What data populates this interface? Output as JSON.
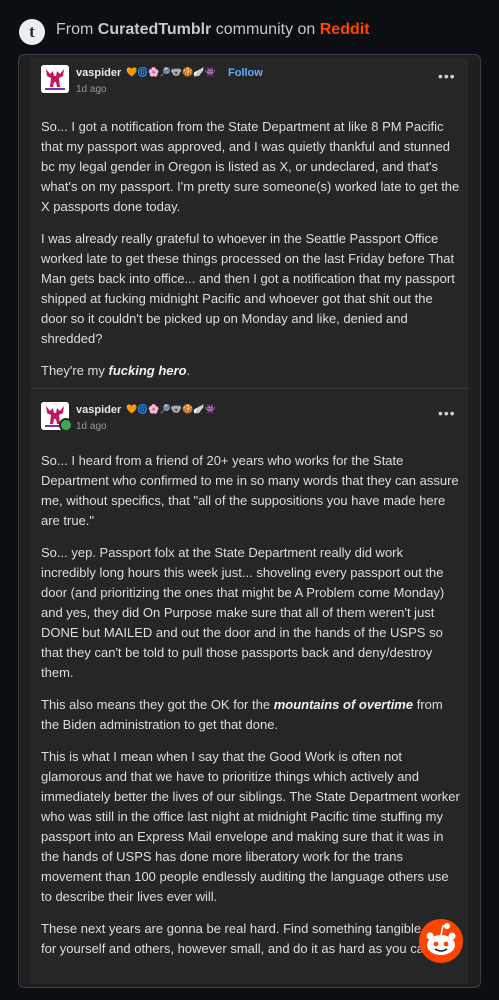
{
  "header": {
    "prefix": "From ",
    "community": "CuratedTumblr",
    "middle": " community on ",
    "site": "Reddit",
    "logo_letter": "t"
  },
  "post1": {
    "username": "vaspider",
    "badges": "🧡🌀🌸🔎🐨🍪🪽👾",
    "follow_label": "Follow",
    "time": "1d ago",
    "more_label": "•••",
    "paragraphs": [
      "So... I got a notification from the State Department at like 8 PM Pacific that my passport was approved, and I was quietly thankful and stunned bc my legal gender in Oregon is listed as X, or undeclared, and that's what's on my passport. I'm pretty sure someone(s) worked late to get the X passports done today.",
      "I was already really grateful to whoever in the Seattle Passport Office worked late to get these things processed on the last Friday before That Man gets back into office... and then I got a notification that my passport shipped at fucking midnight Pacific and whoever got that shit out the door so it couldn't be picked up on Monday and like, denied and shredded?"
    ],
    "p3_prefix": "They're my ",
    "p3_emph": "fucking hero",
    "p3_suffix": "."
  },
  "post2": {
    "username": "vaspider",
    "badges": "🧡🌀🌸🔎🐨🍪🪽👾",
    "time": "1d ago",
    "more_label": "•••",
    "paragraphs": [
      "So... I heard from a friend of 20+ years who works for the State Department who confirmed to me in so many words that they can assure me, without specifics, that \"all of the suppositions you have made here are true.\"",
      "So... yep. Passport folx at the State Department really did work incredibly long hours this week just... shoveling every passport out the door (and prioritizing the ones that might be A Problem come Monday) and yes, they did On Purpose make sure that all of them weren't just DONE but MAILED and out the door and in the hands of the USPS so that they can't be told to pull those passports back and deny/destroy them."
    ],
    "p3_prefix": "This also means they got the OK for the ",
    "p3_emph": "mountains of overtime",
    "p3_suffix": " from the Biden administration to get that done.",
    "paragraphs_after": [
      "This is what I mean when I say that the Good Work is often not glamorous and that we have to prioritize things which actively and immediately better the lives of our siblings. The State Department worker who was still in the office last night at midnight Pacific time stuffing my passport into an Express Mail envelope and making sure that it was in the hands of USPS has done more liberatory work for the trans movement than 100 people endlessly auditing the language others use to describe their lives ever will.",
      "These next years are gonna be real hard. Find something tangible to do for yourself and others, however small, and do it as hard as you can."
    ]
  },
  "colors": {
    "background": "#0b0f13",
    "card": "#262626",
    "reddit_accent": "#ff4500",
    "follow_link": "#5fb0ff"
  },
  "icons": {
    "logo": "tumblr-logo-icon",
    "avatar": "moose-avatar",
    "mascot": "reddit-snoo-icon"
  }
}
